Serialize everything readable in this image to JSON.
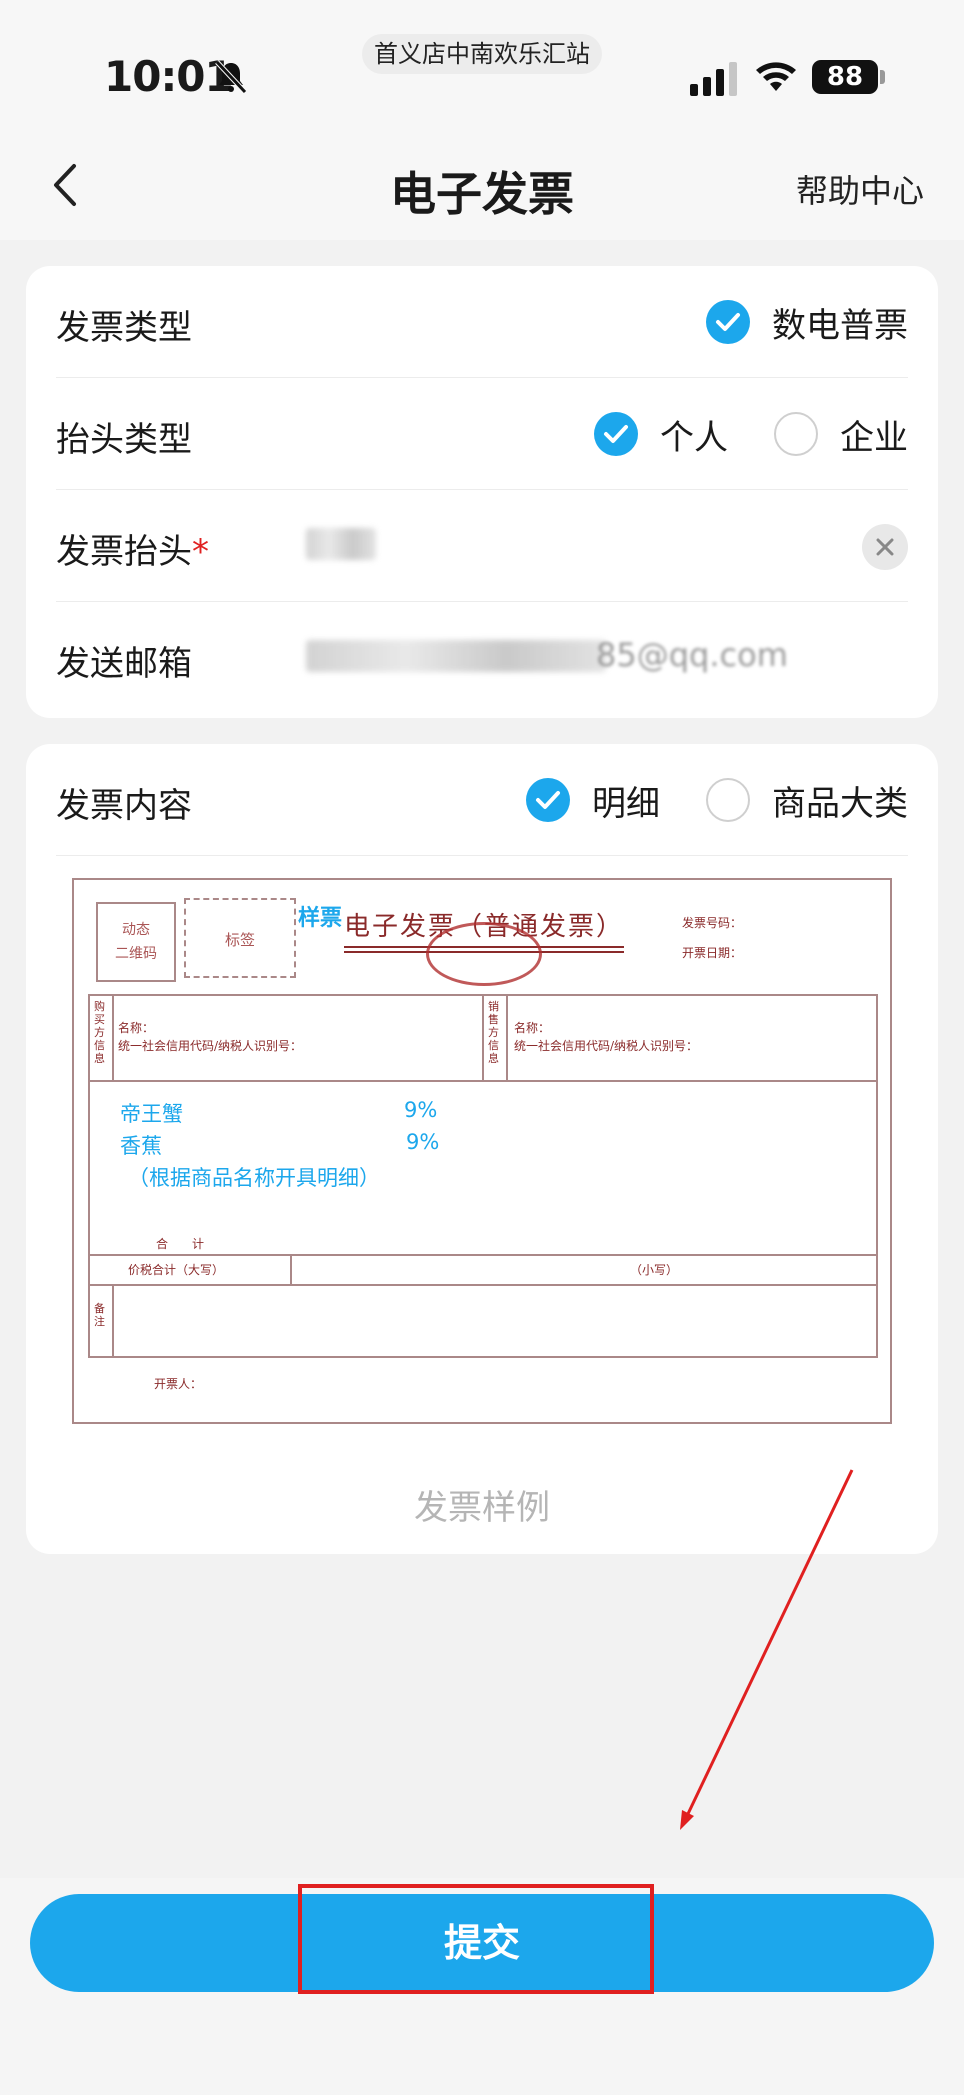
{
  "status_bar": {
    "time": "10:01",
    "dynamic_island_text": "首义店中南欢乐汇站",
    "battery_level": "88"
  },
  "nav": {
    "title": "电子发票",
    "help_label": "帮助中心"
  },
  "invoice_form": {
    "invoice_type": {
      "label": "发票类型",
      "selected": "数电普票"
    },
    "title_type": {
      "label": "抬头类型",
      "options": [
        "个人",
        "企业"
      ],
      "selected": "个人"
    },
    "invoice_title": {
      "label": "发票抬头",
      "required_mark": "*"
    },
    "email": {
      "label": "发送邮箱",
      "value_visible_tail": "85@qq.com"
    }
  },
  "content": {
    "label": "发票内容",
    "options": [
      "明细",
      "商品大类"
    ],
    "selected": "明细",
    "sample_caption": "发票样例",
    "sample": {
      "qr_label": "动态\n二维码",
      "tag_label": "标签",
      "sample_mark": "样票",
      "title": "电子发票（普通发票）",
      "invoice_no": "发票号码：",
      "issue_date": "开票日期：",
      "buyer_side": "购买方信息",
      "seller_side": "销售方信息",
      "name_label": "名称：",
      "tax_id_label": "统一社会信用代码/纳税人识别号：",
      "items": [
        {
          "name": "帝王蟹",
          "rate": "9%"
        },
        {
          "name": "香蕉",
          "rate": "9%"
        }
      ],
      "items_note": "（根据商品名称开具明细）",
      "total_label": "合　　计",
      "total_uppercase_label": "价税合计（大写）",
      "total_lowercase_label": "（小写）",
      "remark_label": "备注",
      "drawer_label": "开票人："
    }
  },
  "actions": {
    "submit_label": "提交"
  },
  "colors": {
    "accent": "#1ca7ec",
    "annotation": "#e02020"
  }
}
